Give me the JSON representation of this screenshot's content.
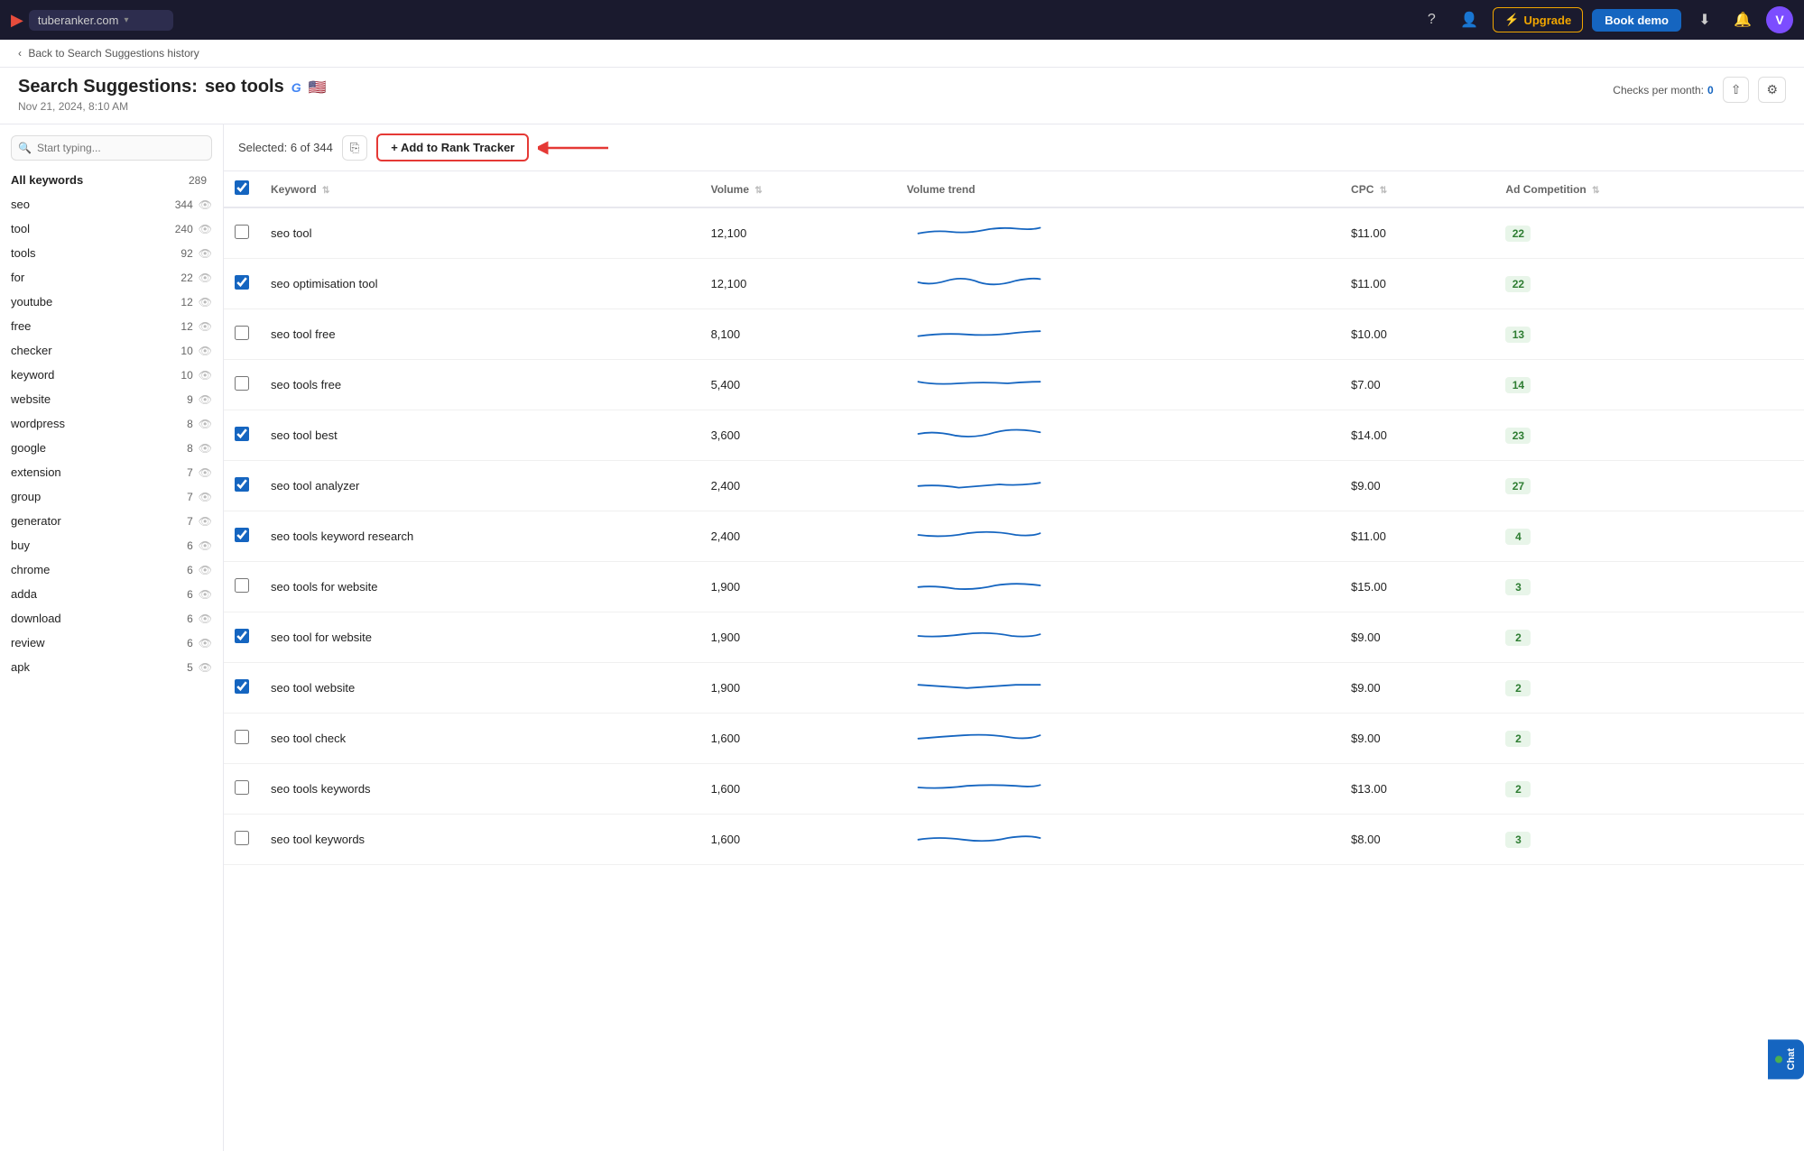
{
  "topnav": {
    "domain": "tuberanker.com",
    "upgrade_label": "Upgrade",
    "book_demo_label": "Book demo",
    "avatar_letter": "V"
  },
  "breadcrumb": {
    "back_label": "Back to Search Suggestions history"
  },
  "page_header": {
    "title_prefix": "Search Suggestions:",
    "keyword": "seo tools",
    "date": "Nov 21, 2024, 8:10 AM",
    "checks_label": "Checks per month:",
    "checks_count": "0"
  },
  "sidebar": {
    "search_placeholder": "Start typing...",
    "items": [
      {
        "label": "All keywords",
        "count": "289",
        "has_eye": false
      },
      {
        "label": "seo",
        "count": "344",
        "has_eye": true
      },
      {
        "label": "tool",
        "count": "240",
        "has_eye": true
      },
      {
        "label": "tools",
        "count": "92",
        "has_eye": true
      },
      {
        "label": "for",
        "count": "22",
        "has_eye": true
      },
      {
        "label": "youtube",
        "count": "12",
        "has_eye": true
      },
      {
        "label": "free",
        "count": "12",
        "has_eye": true
      },
      {
        "label": "checker",
        "count": "10",
        "has_eye": true
      },
      {
        "label": "keyword",
        "count": "10",
        "has_eye": true
      },
      {
        "label": "website",
        "count": "9",
        "has_eye": true
      },
      {
        "label": "wordpress",
        "count": "8",
        "has_eye": true
      },
      {
        "label": "google",
        "count": "8",
        "has_eye": true
      },
      {
        "label": "extension",
        "count": "7",
        "has_eye": true
      },
      {
        "label": "group",
        "count": "7",
        "has_eye": true
      },
      {
        "label": "generator",
        "count": "7",
        "has_eye": true
      },
      {
        "label": "buy",
        "count": "6",
        "has_eye": true
      },
      {
        "label": "chrome",
        "count": "6",
        "has_eye": true
      },
      {
        "label": "adda",
        "count": "6",
        "has_eye": true
      },
      {
        "label": "download",
        "count": "6",
        "has_eye": true
      },
      {
        "label": "review",
        "count": "6",
        "has_eye": true
      },
      {
        "label": "apk",
        "count": "5",
        "has_eye": true
      }
    ]
  },
  "toolbar": {
    "selected_label": "Selected: 6 of 344",
    "add_tracker_label": "+ Add to Rank Tracker"
  },
  "table": {
    "columns": [
      "Keyword",
      "Volume",
      "Volume trend",
      "CPC",
      "Ad Competition"
    ],
    "rows": [
      {
        "keyword": "seo tool",
        "volume": "12,100",
        "cpc": "$11.00",
        "ad_comp": "22",
        "checked": false
      },
      {
        "keyword": "seo optimisation tool",
        "volume": "12,100",
        "cpc": "$11.00",
        "ad_comp": "22",
        "checked": true
      },
      {
        "keyword": "seo tool free",
        "volume": "8,100",
        "cpc": "$10.00",
        "ad_comp": "13",
        "checked": false
      },
      {
        "keyword": "seo tools free",
        "volume": "5,400",
        "cpc": "$7.00",
        "ad_comp": "14",
        "checked": false
      },
      {
        "keyword": "seo tool best",
        "volume": "3,600",
        "cpc": "$14.00",
        "ad_comp": "23",
        "checked": true
      },
      {
        "keyword": "seo tool analyzer",
        "volume": "2,400",
        "cpc": "$9.00",
        "ad_comp": "27",
        "checked": true
      },
      {
        "keyword": "seo tools keyword research",
        "volume": "2,400",
        "cpc": "$11.00",
        "ad_comp": "4",
        "checked": true
      },
      {
        "keyword": "seo tools for website",
        "volume": "1,900",
        "cpc": "$15.00",
        "ad_comp": "3",
        "checked": false
      },
      {
        "keyword": "seo tool for website",
        "volume": "1,900",
        "cpc": "$9.00",
        "ad_comp": "2",
        "checked": true
      },
      {
        "keyword": "seo tool website",
        "volume": "1,900",
        "cpc": "$9.00",
        "ad_comp": "2",
        "checked": true
      },
      {
        "keyword": "seo tool check",
        "volume": "1,600",
        "cpc": "$9.00",
        "ad_comp": "2",
        "checked": false
      },
      {
        "keyword": "seo tools keywords",
        "volume": "1,600",
        "cpc": "$13.00",
        "ad_comp": "2",
        "checked": false
      },
      {
        "keyword": "seo tool keywords",
        "volume": "1,600",
        "cpc": "$8.00",
        "ad_comp": "3",
        "checked": false
      }
    ]
  },
  "chat_fab": "Chat"
}
